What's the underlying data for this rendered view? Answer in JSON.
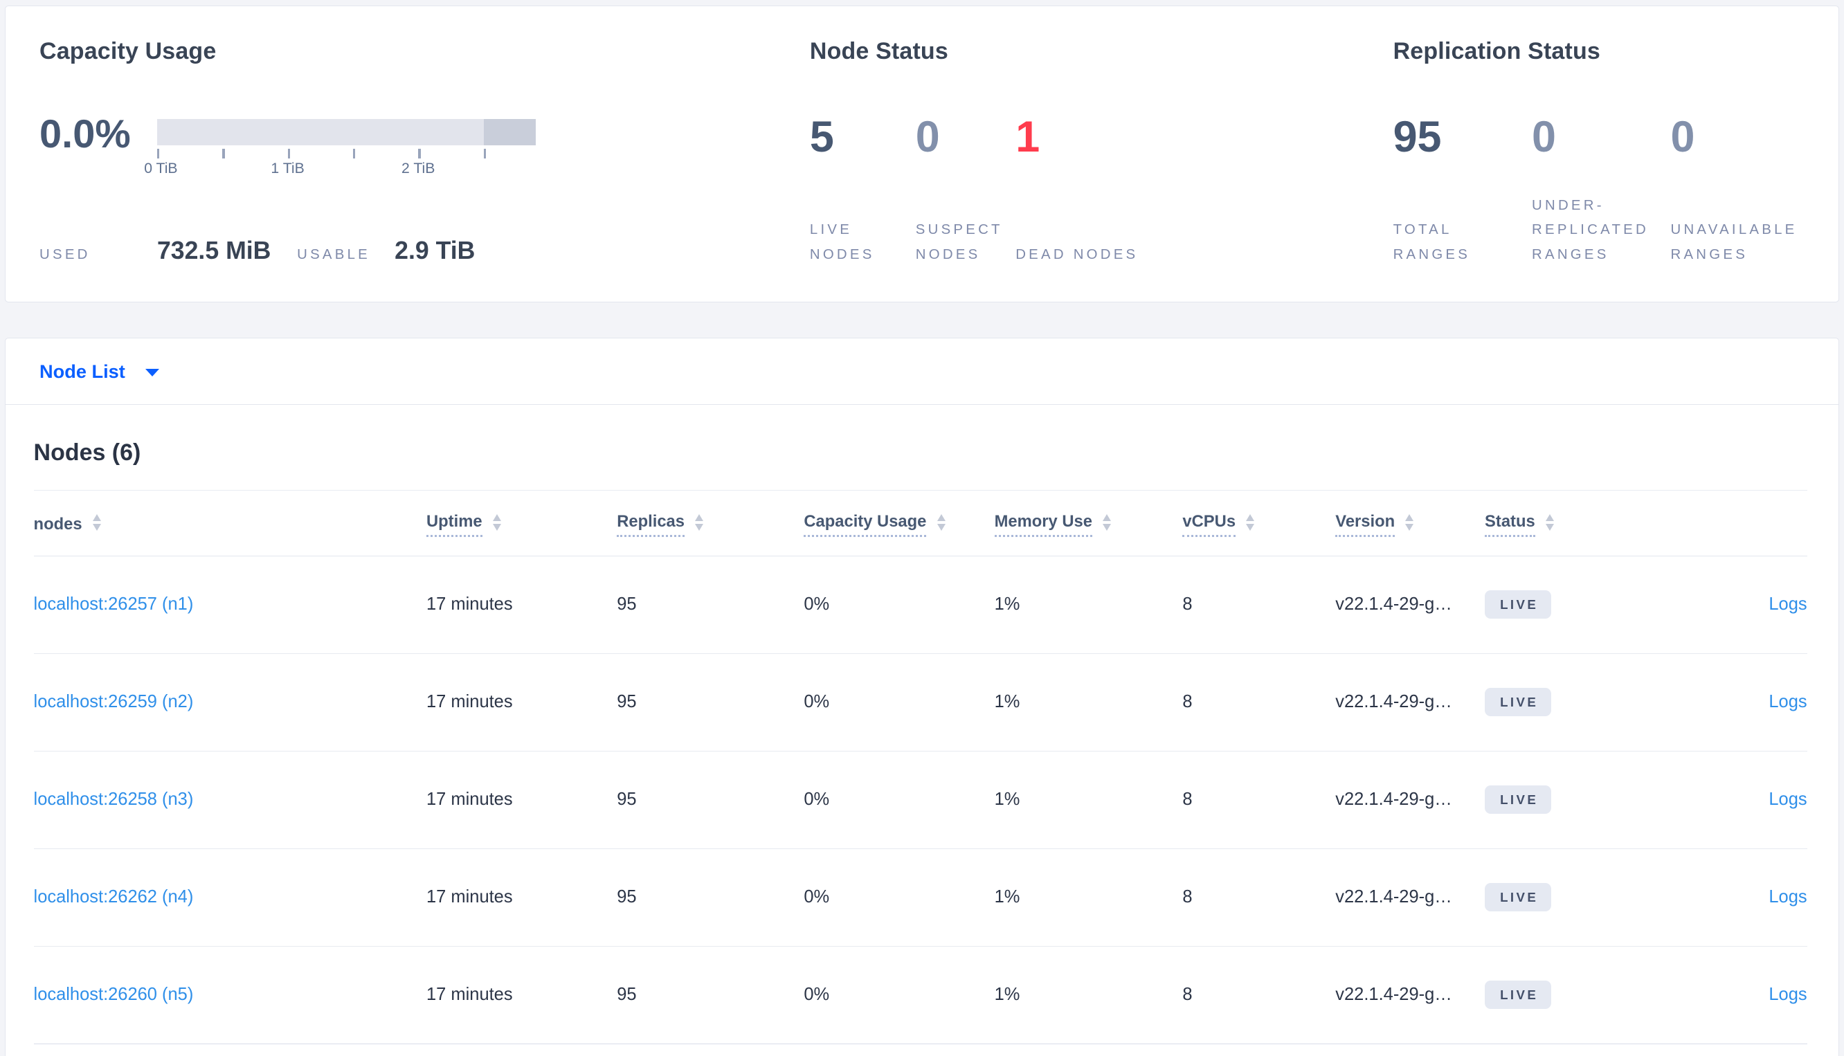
{
  "colors": {
    "accent_blue": "#0b5fff",
    "link_blue": "#2f8fe9",
    "dead_red": "#ff3c4d",
    "dark_slate": "#475872",
    "muted_slate": "#8290ab",
    "badge_bg": "#e5e9f2",
    "bar_light": "#e2e4ec",
    "bar_dark": "#c9ceda"
  },
  "summary": {
    "capacity": {
      "title": "Capacity Usage",
      "percent": "0.0%",
      "tick_labels": [
        "0 TiB",
        "1 TiB",
        "2 TiB"
      ],
      "used_label": "USED",
      "used_value": "732.5 MiB",
      "usable_label": "USABLE",
      "usable_value": "2.9 TiB"
    },
    "node_status": {
      "title": "Node Status",
      "stats": [
        {
          "value": "5",
          "label": "LIVE NODES"
        },
        {
          "value": "0",
          "label": "SUSPECT NODES"
        },
        {
          "value": "1",
          "label": "DEAD NODES"
        }
      ]
    },
    "replication_status": {
      "title": "Replication Status",
      "stats": [
        {
          "value": "95",
          "label": "TOTAL RANGES"
        },
        {
          "value": "0",
          "label": "UNDER-REPLICATED RANGES"
        },
        {
          "value": "0",
          "label": "UNAVAILABLE RANGES"
        }
      ]
    }
  },
  "node_list": {
    "label": "Node List"
  },
  "nodes_section": {
    "title": "Nodes (6)",
    "columns": [
      {
        "label": "nodes"
      },
      {
        "label": "Uptime"
      },
      {
        "label": "Replicas"
      },
      {
        "label": "Capacity Usage"
      },
      {
        "label": "Memory Use"
      },
      {
        "label": "vCPUs"
      },
      {
        "label": "Version"
      },
      {
        "label": "Status"
      }
    ],
    "rows": [
      {
        "node": "localhost:26257 (n1)",
        "uptime": "17 minutes",
        "replicas": "95",
        "capacity_usage": "0%",
        "memory_use": "1%",
        "vcpus": "8",
        "version": "v22.1.4-29-g…",
        "status": "LIVE",
        "logs": "Logs"
      },
      {
        "node": "localhost:26259 (n2)",
        "uptime": "17 minutes",
        "replicas": "95",
        "capacity_usage": "0%",
        "memory_use": "1%",
        "vcpus": "8",
        "version": "v22.1.4-29-g…",
        "status": "LIVE",
        "logs": "Logs"
      },
      {
        "node": "localhost:26258 (n3)",
        "uptime": "17 minutes",
        "replicas": "95",
        "capacity_usage": "0%",
        "memory_use": "1%",
        "vcpus": "8",
        "version": "v22.1.4-29-g…",
        "status": "LIVE",
        "logs": "Logs"
      },
      {
        "node": "localhost:26262 (n4)",
        "uptime": "17 minutes",
        "replicas": "95",
        "capacity_usage": "0%",
        "memory_use": "1%",
        "vcpus": "8",
        "version": "v22.1.4-29-g…",
        "status": "LIVE",
        "logs": "Logs"
      },
      {
        "node": "localhost:26260 (n5)",
        "uptime": "17 minutes",
        "replicas": "95",
        "capacity_usage": "0%",
        "memory_use": "1%",
        "vcpus": "8",
        "version": "v22.1.4-29-g…",
        "status": "LIVE",
        "logs": "Logs"
      }
    ]
  }
}
